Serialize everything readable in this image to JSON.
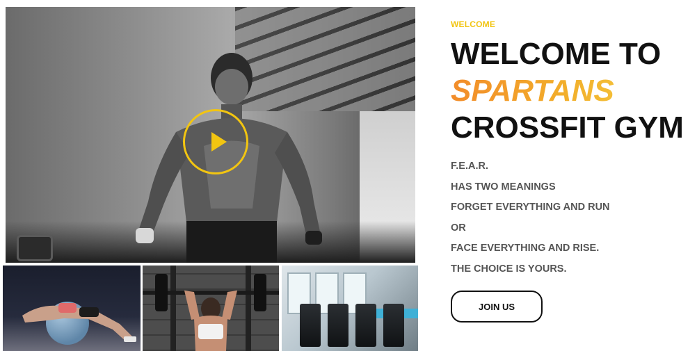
{
  "hero": {
    "play_icon": "play-icon",
    "accent_color": "#f2c511"
  },
  "content": {
    "eyebrow": "WELCOME",
    "title_line1": "WELCOME TO",
    "title_line2": "SPARTANS",
    "title_line3": "CROSSFIT GYM",
    "lines": [
      "F.E.A.R.",
      "HAS TWO MEANINGS",
      "FORGET EVERYTHING AND RUN",
      "OR",
      "FACE EVERYTHING AND RISE.",
      "THE CHOICE IS YOURS."
    ],
    "cta_label": "JOIN US"
  },
  "colors": {
    "accent_yellow": "#f2c511",
    "gradient_orange": "#f28c2a",
    "gradient_yellow": "#f6d84a",
    "heading": "#111111",
    "body_text": "#555555"
  }
}
